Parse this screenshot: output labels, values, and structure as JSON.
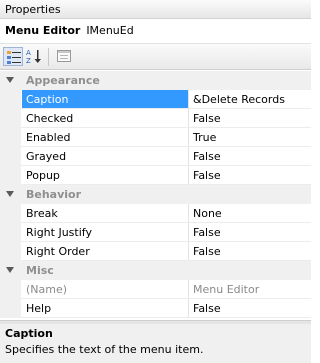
{
  "window": {
    "title": "Properties"
  },
  "object": {
    "name": "Menu Editor",
    "type": "IMenuEd"
  },
  "toolbar": {
    "buttons": [
      {
        "icon": "categorized-icon",
        "pressed": true
      },
      {
        "icon": "alphabetical-sort-icon",
        "pressed": false
      },
      {
        "icon": "property-pages-icon",
        "pressed": false
      }
    ]
  },
  "grid": {
    "categories": [
      {
        "name": "Appearance",
        "properties": [
          {
            "name": "Caption",
            "value": "&Delete Records",
            "selected": true
          },
          {
            "name": "Checked",
            "value": "False"
          },
          {
            "name": "Enabled",
            "value": "True"
          },
          {
            "name": "Grayed",
            "value": "False"
          },
          {
            "name": "Popup",
            "value": "False"
          }
        ]
      },
      {
        "name": "Behavior",
        "properties": [
          {
            "name": "Break",
            "value": "None"
          },
          {
            "name": "Right Justify",
            "value": "False"
          },
          {
            "name": "Right Order",
            "value": "False"
          }
        ]
      },
      {
        "name": "Misc",
        "properties": [
          {
            "name": "(Name)",
            "value": "Menu Editor",
            "readonly": true
          },
          {
            "name": "Help",
            "value": "False"
          }
        ]
      }
    ]
  },
  "description": {
    "title": "Caption",
    "text": "Specifies the text of the menu item."
  },
  "colors": {
    "selection": "#3399ff",
    "gutter": "#f0f0f0",
    "category_text": "#8f8f8f"
  }
}
